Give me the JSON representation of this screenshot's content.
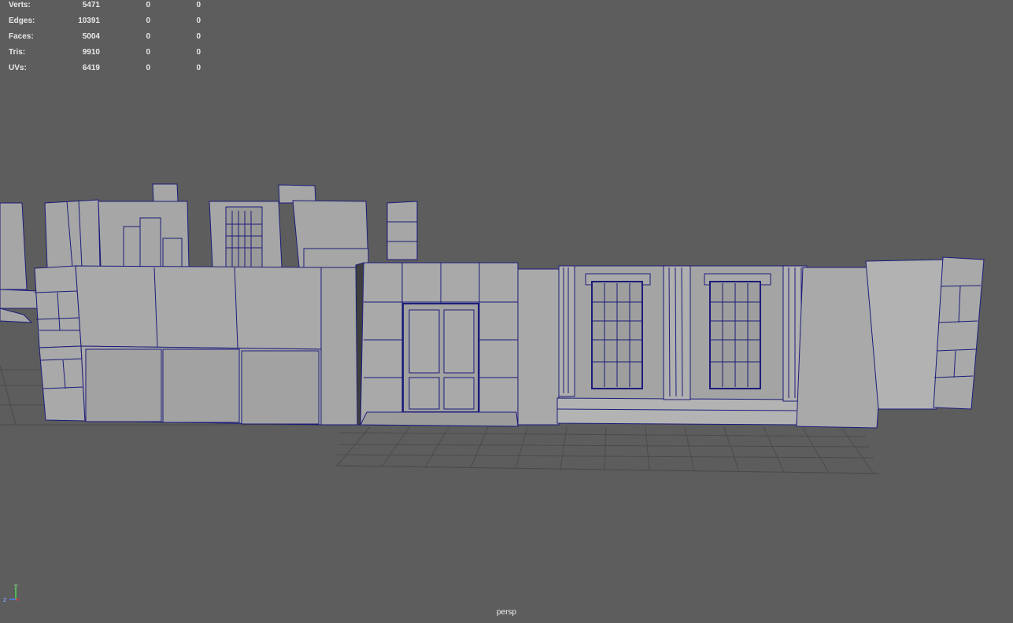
{
  "hud": {
    "rows": [
      {
        "label": "Verts:",
        "total": "5471",
        "selected": "0",
        "component": "0"
      },
      {
        "label": "Edges:",
        "total": "10391",
        "selected": "0",
        "component": "0"
      },
      {
        "label": "Faces:",
        "total": "5004",
        "selected": "0",
        "component": "0"
      },
      {
        "label": "Tris:",
        "total": "9910",
        "selected": "0",
        "component": "0"
      },
      {
        "label": "UVs:",
        "total": "6419",
        "selected": "0",
        "component": "0"
      }
    ]
  },
  "viewport": {
    "camera_label": "persp",
    "axis": {
      "y": "y",
      "z": "z"
    }
  },
  "colors": {
    "background": "#5d5d5d",
    "wireframe": "#1c1c7a",
    "surface": "#a9a9a9",
    "grid": "#4a4a4a"
  }
}
